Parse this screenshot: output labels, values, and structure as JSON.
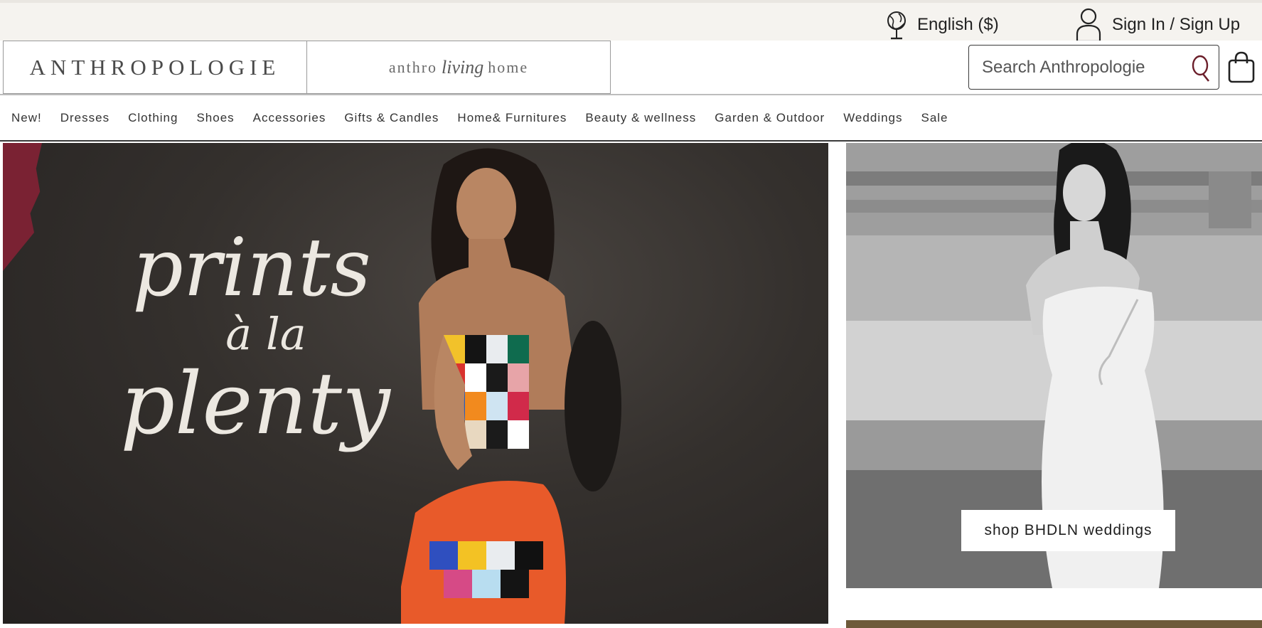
{
  "topbar": {
    "language_label": "English ($)",
    "account_label": "Sign In / Sign Up",
    "globe_icon": "globe-icon",
    "user_icon": "user-icon"
  },
  "brand": {
    "logo_text": "ANTHROPOLOGIE",
    "home_logo_left": "anthro",
    "home_logo_script": "living",
    "home_logo_right": "home"
  },
  "search": {
    "placeholder": "Search Anthropologie",
    "icon": "search-icon"
  },
  "cart": {
    "icon": "shopping-bag-icon"
  },
  "nav": {
    "items": [
      "New!",
      "Dresses",
      "Clothing",
      "Shoes",
      "Accessories",
      "Gifts & Candles",
      "Home& Furnitures",
      "Beauty & wellness",
      "Garden & Outdoor",
      "Weddings",
      "Sale"
    ]
  },
  "hero_left": {
    "script_line1": "prints",
    "script_line2": "à la",
    "script_line3": "plenty"
  },
  "hero_right": {
    "cta_label": "shop BHDLN weddings"
  },
  "colors": {
    "topbar_bg": "#f5f3ef",
    "hero_left_bg": "#34302d",
    "accent_red": "#7a2233"
  }
}
